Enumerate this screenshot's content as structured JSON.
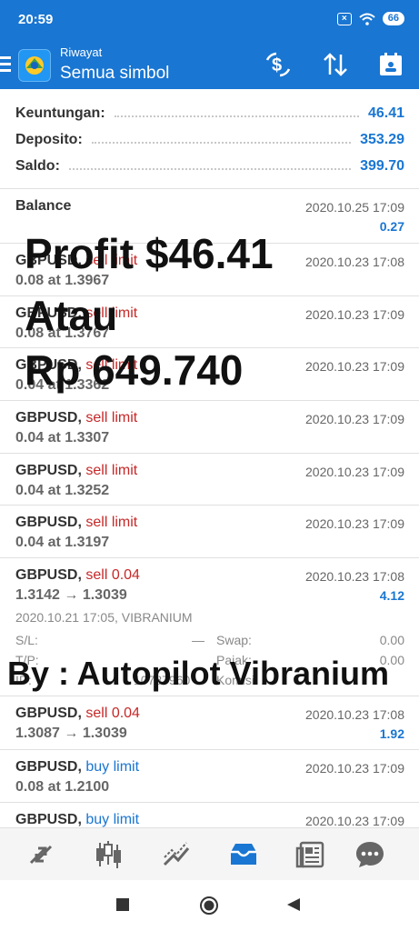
{
  "status": {
    "time": "20:59",
    "battery": "66"
  },
  "header": {
    "subtitle": "Riwayat",
    "title": "Semua simbol"
  },
  "summary": [
    {
      "label": "Keuntungan:",
      "value": "46.41"
    },
    {
      "label": "Deposito:",
      "value": "353.29"
    },
    {
      "label": "Saldo:",
      "value": "399.70"
    }
  ],
  "balance": {
    "label": "Balance",
    "time": "2020.10.25 17:09",
    "amount": "0.27"
  },
  "orders": [
    {
      "symbol": "GBPUSD,",
      "type": "sell limit",
      "detail": "0.08 at 1.3967",
      "time": "2020.10.23 17:08"
    },
    {
      "symbol": "GBPUSD,",
      "type": "sell limit",
      "detail": "0.08 at 1.3767",
      "time": "2020.10.23 17:09"
    },
    {
      "symbol": "GBPUSD,",
      "type": "sell limit",
      "detail": "0.04 at 1.3362",
      "time": "2020.10.23 17:09"
    },
    {
      "symbol": "GBPUSD,",
      "type": "sell limit",
      "detail": "0.04 at 1.3307",
      "time": "2020.10.23 17:09"
    },
    {
      "symbol": "GBPUSD,",
      "type": "sell limit",
      "detail": "0.04 at 1.3252",
      "time": "2020.10.23 17:09"
    },
    {
      "symbol": "GBPUSD,",
      "type": "sell limit",
      "detail": "0.04 at 1.3197",
      "time": "2020.10.23 17:09"
    }
  ],
  "deal1": {
    "symbol": "GBPUSD,",
    "type": "sell 0.04",
    "detail": "1.3142 → 1.3039",
    "time": "2020.10.23 17:08",
    "profit": "4.12",
    "open_info": "2020.10.21 17:05, VIBRANIUM",
    "sl_label": "S/L:",
    "sl_value": "—",
    "swap_label": "Swap:",
    "swap_value": "0.00",
    "tp_label": "T/P:",
    "tax_label": "Pajak:",
    "tax_value": "0.00",
    "id_label": "ID:",
    "id_value": "10787960",
    "commission_label": "Komisi:"
  },
  "deal2": {
    "symbol": "GBPUSD,",
    "type": "sell 0.04",
    "detail": "1.3087 → 1.3039",
    "time": "2020.10.23 17:08",
    "profit": "1.92"
  },
  "buy_orders": [
    {
      "symbol": "GBPUSD,",
      "type": "buy limit",
      "detail": "0.08 at 1.2100",
      "time": "2020.10.23 17:09"
    },
    {
      "symbol": "GBPUSD,",
      "type": "buy limit",
      "detail": "",
      "time": "2020.10.23 17:09"
    }
  ],
  "overlay": {
    "line1": "Profit $46.41",
    "line2": "Atau",
    "line3": "Rp 649.740",
    "credit": "By : Autopilot Vibranium"
  },
  "toolbar_icons": [
    "quotes-icon",
    "chart-icon",
    "trade-icon",
    "history-icon",
    "news-icon",
    "chat-icon"
  ],
  "colors": {
    "primary": "#1976d2",
    "sell": "#c62828",
    "buy": "#1976d2"
  }
}
